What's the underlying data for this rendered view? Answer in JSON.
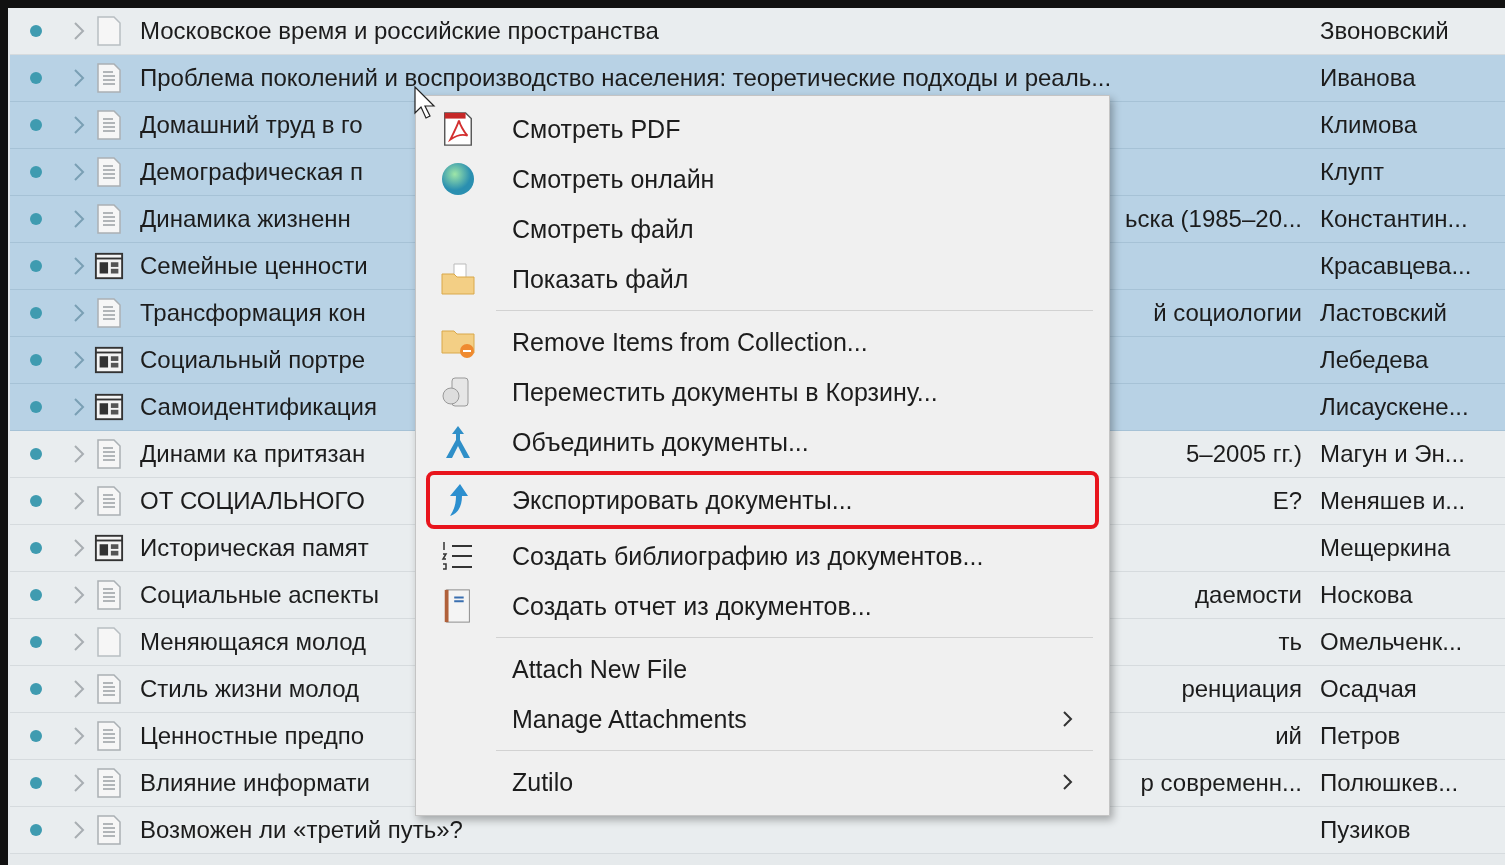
{
  "items": [
    {
      "title": "Московское время и российские пространства",
      "creator": "Звоновский",
      "kind": "blank",
      "selected": false
    },
    {
      "title": "Проблема поколений и воспроизводство населения: теоретические подходы и реаль...",
      "creator": "Иванова",
      "kind": "document",
      "selected": true
    },
    {
      "title": "Домашний труд в го",
      "creator": "Климова",
      "kind": "document",
      "selected": true
    },
    {
      "title": "Демографическая п",
      "creator": "Клупт",
      "kind": "document",
      "selected": true
    },
    {
      "title": "Динамика жизненн",
      "title_tail": "ьска (1985–20...",
      "creator": "Константин...",
      "kind": "document",
      "selected": true
    },
    {
      "title": "Семейные ценности",
      "creator": "Красавцева...",
      "kind": "report",
      "selected": true
    },
    {
      "title": "Трансформация кон",
      "title_tail": "й социологии",
      "creator": "Ластовский",
      "kind": "document",
      "selected": true
    },
    {
      "title": "Социальный портре",
      "creator": "Лебедева",
      "kind": "report",
      "selected": true
    },
    {
      "title": "Самоидентификация",
      "creator": "Лисаускене...",
      "kind": "report",
      "selected": true
    },
    {
      "title": "Динами ка притязан",
      "title_tail": "5–2005 гг.)",
      "creator": "Магун и Эн...",
      "kind": "document",
      "selected": false
    },
    {
      "title": "ОТ СОЦИАЛЬНОГО",
      "title_tail": "Е?",
      "creator": "Меняшев и...",
      "kind": "document",
      "selected": false
    },
    {
      "title": "Историческая памят",
      "creator": "Мещеркина",
      "kind": "report",
      "selected": false
    },
    {
      "title": "Социальные аспекты",
      "title_tail": "даемости",
      "creator": "Носкова",
      "kind": "document",
      "selected": false
    },
    {
      "title": "Меняющаяся молод",
      "title_tail": "ть",
      "creator": "Омельченк...",
      "kind": "blank",
      "selected": false
    },
    {
      "title": "Стиль жизни молод",
      "title_tail": "ренциация",
      "creator": "Осадчая",
      "kind": "document",
      "selected": false
    },
    {
      "title": "Ценностные предпо",
      "title_tail": "ий",
      "creator": "Петров",
      "kind": "document",
      "selected": false
    },
    {
      "title": "Влияние информати",
      "title_tail": "р современн...",
      "creator": "Полюшкев...",
      "kind": "document",
      "selected": false
    },
    {
      "title": "Возможен ли «третий путь»?",
      "creator": "Пузиков",
      "kind": "document",
      "selected": false
    }
  ],
  "context_menu": {
    "items": [
      {
        "kind": "item",
        "label": "Смотреть PDF",
        "submenu": false,
        "highlighted": false
      },
      {
        "kind": "item",
        "label": "Смотреть онлайн",
        "submenu": false,
        "highlighted": false
      },
      {
        "kind": "item",
        "label": "Смотреть файл",
        "submenu": false,
        "highlighted": false
      },
      {
        "kind": "item",
        "label": "Показать файл",
        "submenu": false,
        "highlighted": false
      },
      {
        "kind": "separator"
      },
      {
        "kind": "item",
        "label": "Remove Items from Collection...",
        "submenu": false,
        "highlighted": false
      },
      {
        "kind": "item",
        "label": "Переместить документы в Корзину...",
        "submenu": false,
        "highlighted": false
      },
      {
        "kind": "item",
        "label": "Объединить документы...",
        "submenu": false,
        "highlighted": false
      },
      {
        "kind": "item",
        "label": "Экспортировать документы...",
        "submenu": false,
        "highlighted": true
      },
      {
        "kind": "item",
        "label": "Создать библиографию из документов...",
        "submenu": false,
        "highlighted": false
      },
      {
        "kind": "item",
        "label": "Создать отчет из документов...",
        "submenu": false,
        "highlighted": false
      },
      {
        "kind": "separator"
      },
      {
        "kind": "item",
        "label": "Attach New File",
        "submenu": false,
        "highlighted": false
      },
      {
        "kind": "item",
        "label": "Manage Attachments",
        "submenu": true,
        "highlighted": false
      },
      {
        "kind": "separator"
      },
      {
        "kind": "item",
        "label": "Zutilo",
        "submenu": true,
        "highlighted": false
      }
    ]
  }
}
